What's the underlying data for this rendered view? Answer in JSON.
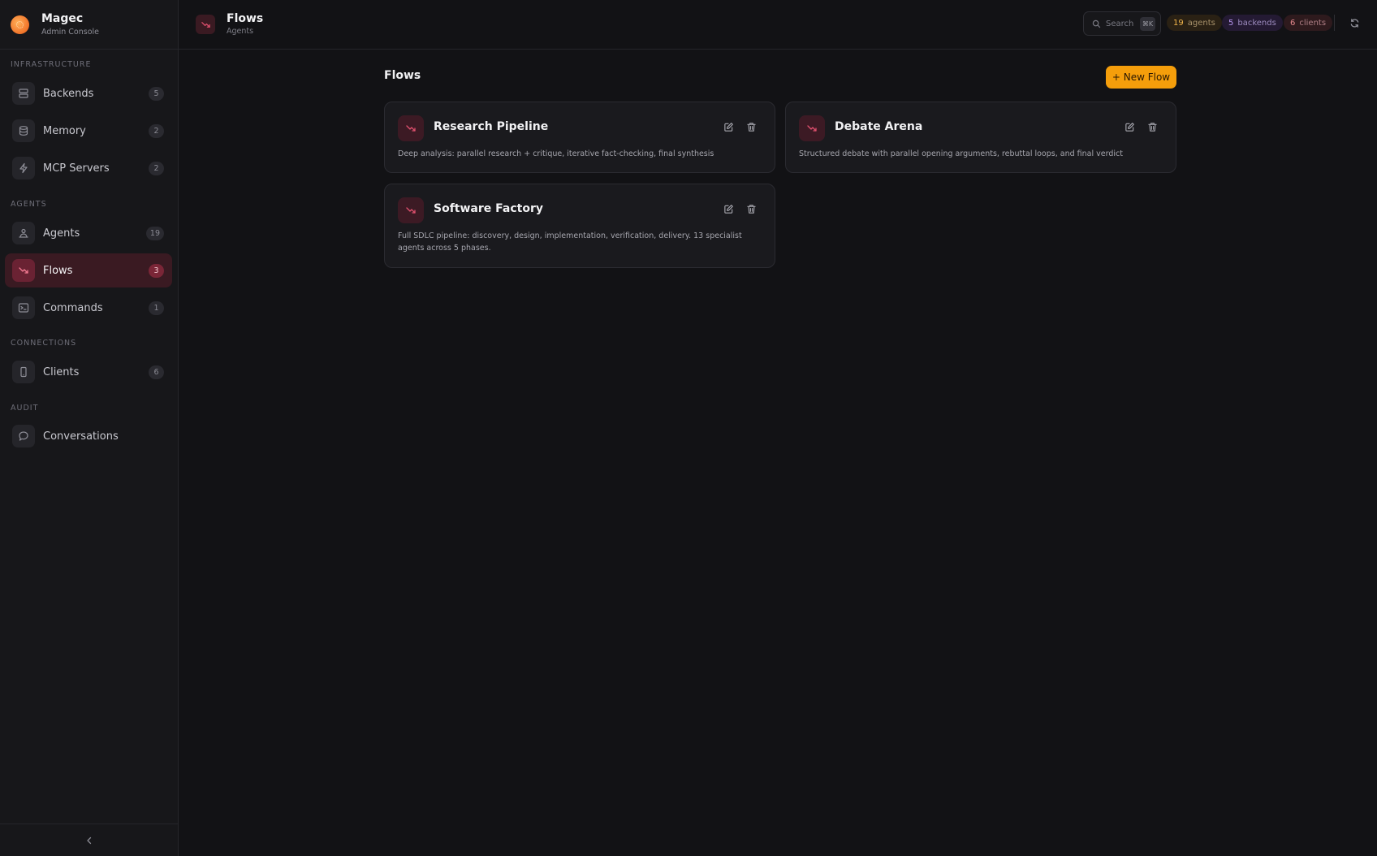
{
  "brand": {
    "name": "Magec",
    "subtitle": "Admin Console"
  },
  "sidebar": {
    "sections": [
      {
        "label": "INFRASTRUCTURE"
      },
      {
        "label": "AGENTS"
      },
      {
        "label": "CONNECTIONS"
      },
      {
        "label": "AUDIT"
      }
    ],
    "items": [
      {
        "label": "Backends",
        "count": "5",
        "icon": "server-icon"
      },
      {
        "label": "Memory",
        "count": "2",
        "icon": "database-icon"
      },
      {
        "label": "MCP Servers",
        "count": "2",
        "icon": "bolt-icon"
      },
      {
        "label": "Agents",
        "count": "19",
        "icon": "agents-icon"
      },
      {
        "label": "Flows",
        "count": "3",
        "icon": "flow-icon",
        "active": true
      },
      {
        "label": "Commands",
        "count": "1",
        "icon": "terminal-icon"
      },
      {
        "label": "Clients",
        "count": "6",
        "icon": "device-icon"
      },
      {
        "label": "Conversations",
        "icon": "chat-icon"
      }
    ],
    "collapse_icon": "chevron-left-icon"
  },
  "header": {
    "title": "Flows",
    "subtitle": "Agents",
    "search": {
      "placeholder": "Search",
      "shortcut": "⌘K"
    },
    "stats": {
      "agents": {
        "count": "19",
        "label": "agents"
      },
      "backends": {
        "count": "5",
        "label": "backends"
      },
      "clients": {
        "count": "6",
        "label": "clients"
      }
    }
  },
  "main": {
    "title": "Flows",
    "new_button": "+ New Flow",
    "flows": [
      {
        "name": "Research Pipeline",
        "description": "Deep analysis: parallel research + critique, iterative fact-checking, final synthesis"
      },
      {
        "name": "Debate Arena",
        "description": "Structured debate with parallel opening arguments, rebuttal loops, and final verdict"
      },
      {
        "name": "Software Factory",
        "description": "Full SDLC pipeline: discovery, design, implementation, verification, delivery. 13 specialist agents across 5 phases."
      }
    ]
  },
  "colors": {
    "accent": "#f59e0b",
    "flow_accent": "#e0506e",
    "background": "#121215",
    "sidebar": "#17171a"
  }
}
